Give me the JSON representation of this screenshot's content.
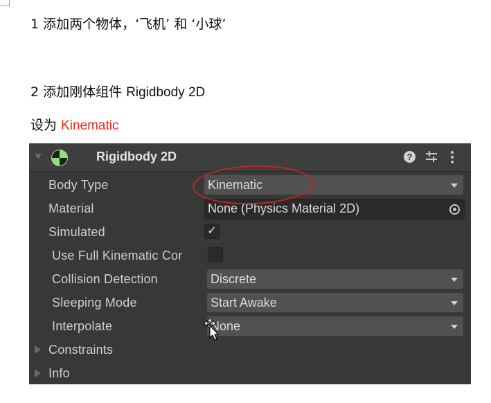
{
  "doc": {
    "line1": "1 添加两个物体，‘飞机’ 和  ‘小球’",
    "line2_prefix": "2 添加刚体组件 ",
    "line2_component": "Rigidbody 2D",
    "line3_prefix": "设为 ",
    "line3_value": "Kinematic"
  },
  "inspector": {
    "title": "Rigidbody 2D",
    "help_glyph": "?",
    "header_icons": [
      "rigidbody2d-icon",
      "help-icon",
      "preset-icon",
      "context-menu-icon"
    ],
    "body_type": {
      "label": "Body Type",
      "value": "Kinematic"
    },
    "material": {
      "label": "Material",
      "value": "None (Physics Material 2D)"
    },
    "simulated": {
      "label": "Simulated",
      "checked": true,
      "mark": "✓"
    },
    "use_full_kinematic": {
      "label": "Use Full Kinematic Cor",
      "checked": false
    },
    "collision_detection": {
      "label": "Collision Detection",
      "value": "Discrete"
    },
    "sleeping_mode": {
      "label": "Sleeping Mode",
      "value": "Start Awake"
    },
    "interpolate": {
      "label": "Interpolate",
      "value": "None"
    },
    "constraints": {
      "label": "Constraints"
    },
    "info": {
      "label": "Info"
    }
  },
  "colors": {
    "panel_bg": "#383838",
    "field_bg": "#515151",
    "highlight_red": "#e8261b",
    "annotation_ellipse": "#c0262a"
  }
}
